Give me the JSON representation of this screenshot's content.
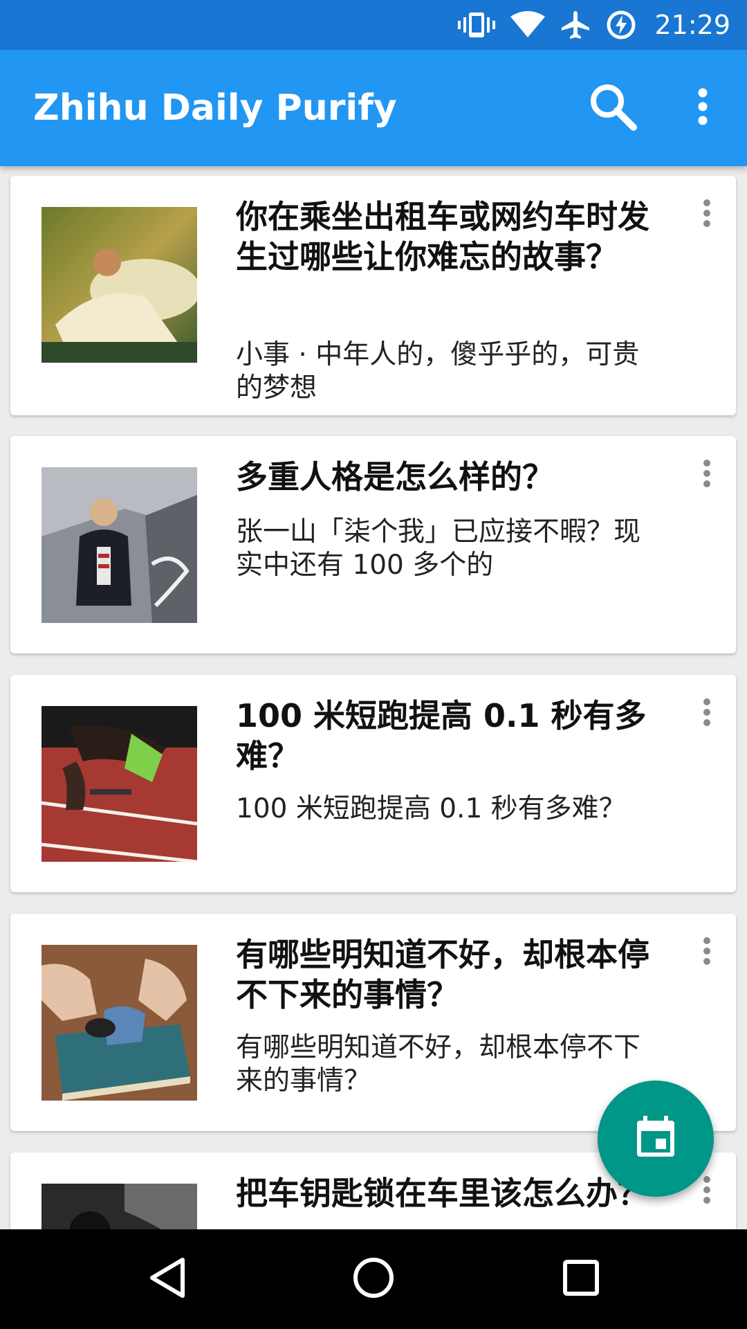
{
  "status_bar": {
    "time": "21:29",
    "icons": [
      "vibrate-icon",
      "wifi-icon",
      "airplane-mode-icon",
      "battery-saver-icon"
    ]
  },
  "app_bar": {
    "title": "Zhihu Daily Purify",
    "actions": [
      "search-icon",
      "more-vert-icon"
    ]
  },
  "stories": [
    {
      "title": "你在乘坐出租车或网约车时发生过哪些让你难忘的故事？",
      "summary": "小事 · 中年人的，傻乎乎的，可贵的梦想",
      "thumbnail": "man-reclining-on-couch-photo"
    },
    {
      "title": "多重人格是怎么样的？",
      "summary": "张一山「柒个我」已应接不暇？现实中还有 100 多个的",
      "thumbnail": "actor-poster-photo"
    },
    {
      "title": "100 米短跑提高 0.1 秒有多难？",
      "summary": "100 米短跑提高 0.1 秒有多难？",
      "thumbnail": "sprinter-start-photo"
    },
    {
      "title": "有哪些明知道不好，却根本停不下来的事情？",
      "summary": "有哪些明知道不好，却根本停不下来的事情？",
      "thumbnail": "cleaning-glasses-photo"
    },
    {
      "title": "把车钥匙锁在车里该怎么办？",
      "summary": "",
      "thumbnail": "car-interior-photo"
    }
  ],
  "fab": {
    "icon": "calendar-icon",
    "color": "#009688"
  },
  "nav_bar": {
    "buttons": [
      "back-icon",
      "home-icon",
      "recents-icon"
    ]
  },
  "colors": {
    "status_bar": "#1976d2",
    "app_bar": "#2196f3",
    "fab": "#009688",
    "background": "#ececec"
  }
}
